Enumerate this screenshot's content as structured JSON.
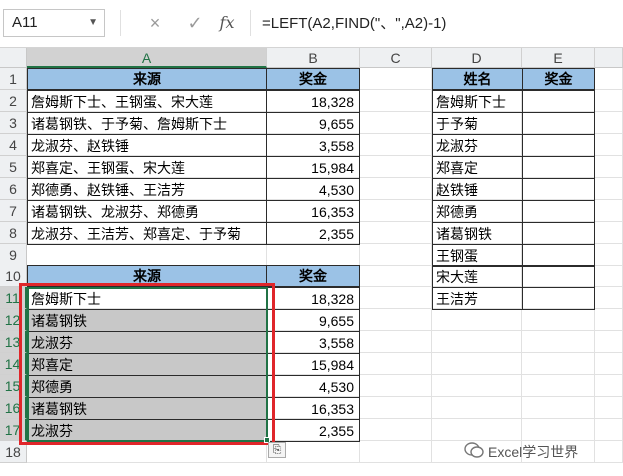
{
  "formula_bar": {
    "name_box": "A11",
    "cancel_icon": "×",
    "enter_icon": "✓",
    "fx_label": "fx",
    "formula": "=LEFT(A2,FIND(\"、\",A2)-1)"
  },
  "columns": [
    "A",
    "B",
    "C",
    "D",
    "E"
  ],
  "rows": [
    "1",
    "2",
    "3",
    "4",
    "5",
    "6",
    "7",
    "8",
    "9",
    "10",
    "11",
    "12",
    "13",
    "14",
    "15",
    "16",
    "17",
    "18"
  ],
  "table1": {
    "header_source": "来源",
    "header_bonus": "奖金",
    "rows": [
      {
        "source": "詹姆斯下士、王钢蛋、宋大莲",
        "bonus": "18,328"
      },
      {
        "source": "诸葛钢铁、于予菊、詹姆斯下士",
        "bonus": "9,655"
      },
      {
        "source": "龙淑芬、赵铁锤",
        "bonus": "3,558"
      },
      {
        "source": "郑喜定、王钢蛋、宋大莲",
        "bonus": "15,984"
      },
      {
        "source": "郑德勇、赵铁锤、王洁芳",
        "bonus": "4,530"
      },
      {
        "source": "诸葛钢铁、龙淑芬、郑德勇",
        "bonus": "16,353"
      },
      {
        "source": "龙淑芬、王洁芳、郑喜定、于予菊",
        "bonus": "2,355"
      }
    ]
  },
  "table2": {
    "header_source": "来源",
    "header_bonus": "奖金",
    "rows": [
      {
        "source": "詹姆斯下士",
        "bonus": "18,328"
      },
      {
        "source": "诸葛钢铁",
        "bonus": "9,655"
      },
      {
        "source": "龙淑芬",
        "bonus": "3,558"
      },
      {
        "source": "郑喜定",
        "bonus": "15,984"
      },
      {
        "source": "郑德勇",
        "bonus": "4,530"
      },
      {
        "source": "诸葛钢铁",
        "bonus": "16,353"
      },
      {
        "source": "龙淑芬",
        "bonus": "2,355"
      }
    ]
  },
  "table3": {
    "header_name": "姓名",
    "header_bonus": "奖金",
    "names": [
      "詹姆斯下士",
      "于予菊",
      "龙淑芬",
      "郑喜定",
      "赵铁锤",
      "郑德勇",
      "诸葛钢铁",
      "王钢蛋",
      "宋大莲",
      "王洁芳"
    ]
  },
  "paste_options_icon": "⎘",
  "watermark": "Excel学习世界",
  "colors": {
    "header_fill": "#9bc2e6",
    "selection_fill": "#c8c8c8",
    "highlight_border": "#e0262a",
    "active_border": "#217346"
  }
}
